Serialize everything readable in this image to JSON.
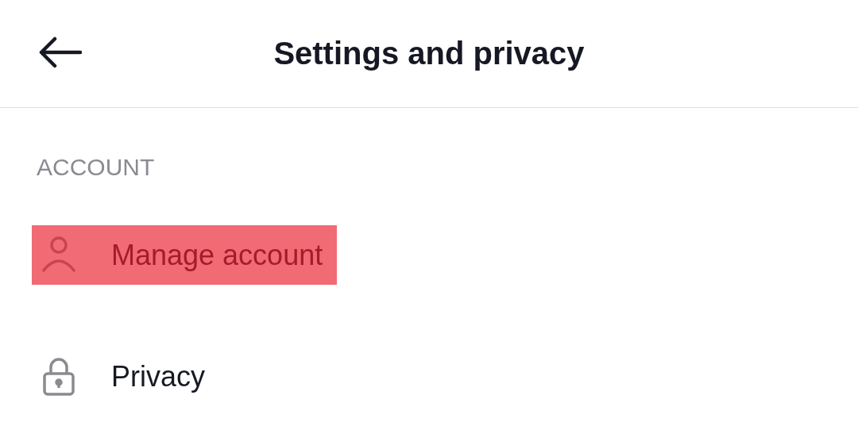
{
  "header": {
    "title": "Settings and privacy"
  },
  "section": {
    "label": "ACCOUNT",
    "items": [
      {
        "kind": "person",
        "label": "Manage account",
        "highlighted": true
      },
      {
        "kind": "lock",
        "label": "Privacy",
        "highlighted": false
      }
    ]
  }
}
